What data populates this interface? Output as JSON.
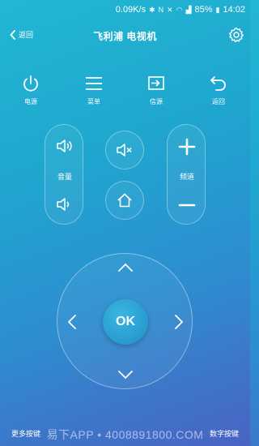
{
  "status_bar": {
    "speed": "0.09K/s",
    "battery": "85%",
    "time": "14:02"
  },
  "nav": {
    "back_label": "返回",
    "title": "飞利浦 电视机"
  },
  "toolbar": {
    "power_label": "电源",
    "menu_label": "菜单",
    "source_label": "信源",
    "return_label": "返回"
  },
  "volume": {
    "label": "音量"
  },
  "channel": {
    "label": "频道"
  },
  "dpad": {
    "ok_label": "OK"
  },
  "bottom": {
    "more_keys": "更多按键",
    "number_keys": "数字按键",
    "watermark": "易下APP • 4008891800.COM"
  },
  "colors": {
    "bg_top": "#21b7d3",
    "bg_bottom": "#4a63c4",
    "ok_button": "#1f8fc7"
  },
  "icons": {
    "status": [
      "bluetooth-icon",
      "nfc-icon",
      "mute-icon",
      "wifi-icon",
      "signal-icon",
      "battery-icon"
    ],
    "toolbar": [
      "power-icon",
      "menu-icon",
      "source-icon",
      "return-icon"
    ]
  }
}
